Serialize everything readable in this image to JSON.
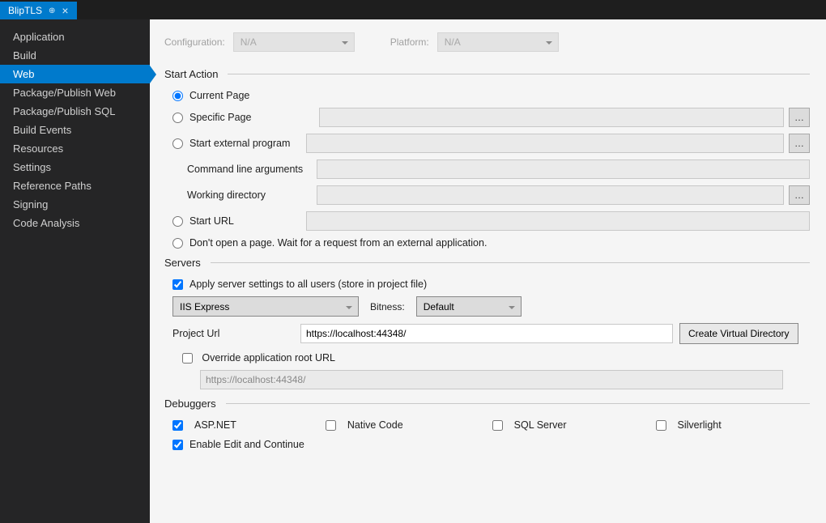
{
  "tab": {
    "title": "BlipTLS"
  },
  "sidebar": {
    "items": [
      {
        "label": "Application"
      },
      {
        "label": "Build"
      },
      {
        "label": "Web"
      },
      {
        "label": "Package/Publish Web"
      },
      {
        "label": "Package/Publish SQL"
      },
      {
        "label": "Build Events"
      },
      {
        "label": "Resources"
      },
      {
        "label": "Settings"
      },
      {
        "label": "Reference Paths"
      },
      {
        "label": "Signing"
      },
      {
        "label": "Code Analysis"
      }
    ],
    "activeIndex": 2
  },
  "top": {
    "config_label": "Configuration:",
    "config_value": "N/A",
    "platform_label": "Platform:",
    "platform_value": "N/A"
  },
  "startAction": {
    "title": "Start Action",
    "current_page": "Current Page",
    "specific_page": "Specific Page",
    "start_external": "Start external program",
    "cmd_args_label": "Command line arguments",
    "working_dir_label": "Working directory",
    "start_url": "Start URL",
    "dont_open": "Don't open a page.  Wait for a request from an external application."
  },
  "servers": {
    "title": "Servers",
    "apply_all": "Apply server settings to all users (store in project file)",
    "server_select": "IIS Express",
    "bitness_label": "Bitness:",
    "bitness_value": "Default",
    "project_url_label": "Project Url",
    "project_url_value": "https://localhost:44348/",
    "create_vdir": "Create Virtual Directory",
    "override_label": "Override application root URL",
    "override_value": "https://localhost:44348/"
  },
  "debuggers": {
    "title": "Debuggers",
    "aspnet": "ASP.NET",
    "native": "Native Code",
    "sqlserver": "SQL Server",
    "silverlight": "Silverlight",
    "edit_continue": "Enable Edit and Continue"
  }
}
